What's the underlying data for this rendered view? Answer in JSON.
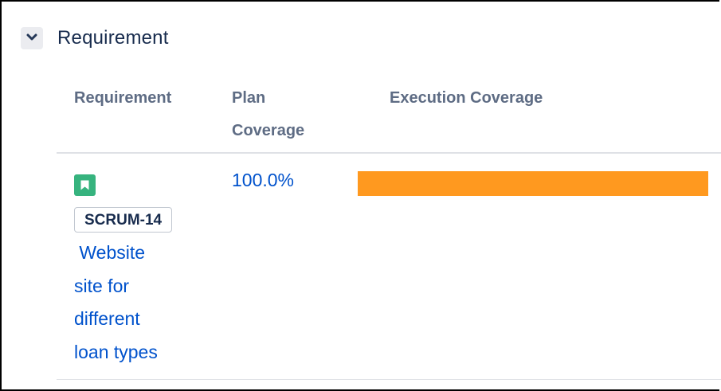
{
  "section": {
    "title": "Requirement",
    "expanded": true
  },
  "table": {
    "headers": {
      "requirement": "Requirement",
      "plan_coverage": "Plan\nCoverage",
      "execution_coverage": "Execution Coverage"
    },
    "rows": [
      {
        "issue_type_icon": "story-icon",
        "issue_key": "SCRUM-14",
        "issue_title": " Website\nsite for\ndifferent\nloan types",
        "plan_coverage": "100.0%",
        "execution_coverage_fraction": 1.0
      }
    ]
  },
  "colors": {
    "link": "#0052cc",
    "story": "#36b37e",
    "execution_bar": "#ff991f",
    "header_text": "#5e6c84"
  }
}
